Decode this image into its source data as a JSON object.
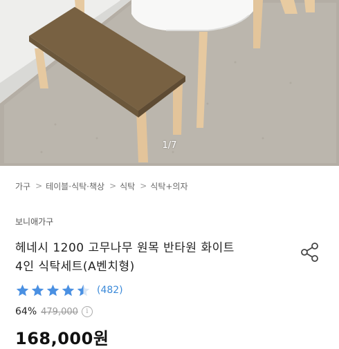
{
  "gallery": {
    "page_indicator": "1/7"
  },
  "breadcrumb": {
    "items": [
      "가구",
      "테이블·식탁·책상",
      "식탁",
      "식탁+의자"
    ]
  },
  "product": {
    "seller": "보니애가구",
    "title_line1": "헤네시 1200 고무나무 원목 반타원 화이트",
    "title_line2": "4인 식탁세트(A벤치형)",
    "rating": 4.5,
    "review_count": "(482)",
    "discount_rate": "64%",
    "original_price": "479,000",
    "sale_price": "168,000원"
  },
  "icons": {
    "share": "share-icon",
    "info": "info-icon",
    "star": "star-icon"
  },
  "colors": {
    "star": "#4a90e2",
    "review_count": "#3b8ad9"
  }
}
